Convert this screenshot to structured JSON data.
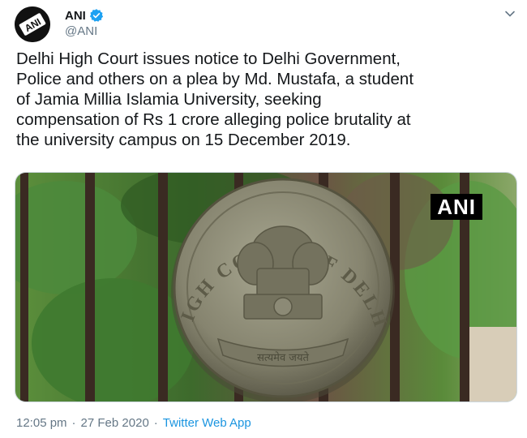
{
  "author": {
    "display_name": "ANI",
    "handle": "@ANI",
    "avatar_text": "ANI",
    "avatar_icon": "ani-logo-icon",
    "verified_icon": "verified-badge-icon",
    "verified_color": "#1da1f2"
  },
  "menu_icon": "chevron-down-icon",
  "tweet": {
    "text": "Delhi High Court issues notice to Delhi Government,\nPolice and others on a plea by Md. Mustafa, a student\nof Jamia Millia Islamia University, seeking\ncompensation of Rs 1 crore alleging police brutality at\nthe university campus on 15 December 2019."
  },
  "media": {
    "watermark": "ANI",
    "emblem_text_top": "HIGH COURT OF DELHI",
    "emblem_motto": "सत्यमेव जयते",
    "colors": {
      "foliage": "#4c8a3c",
      "gate": "#3a2a22",
      "emblem": "#8c8a78"
    }
  },
  "meta": {
    "time": "12:05 pm",
    "separator": "·",
    "date": "27 Feb 2020",
    "source": "Twitter Web App",
    "source_color": "#1b95e0"
  }
}
